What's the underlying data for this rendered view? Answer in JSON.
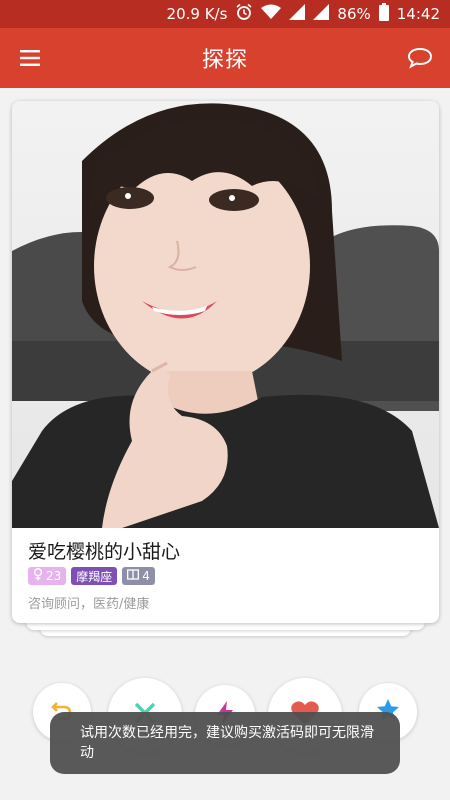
{
  "status_bar": {
    "speed": "20.9 K/s",
    "battery": "86%",
    "time": "14:42"
  },
  "app_bar": {
    "title": "探探"
  },
  "profile": {
    "name": "爱吃樱桃的小甜心",
    "age": "23",
    "zodiac": "摩羯座",
    "photo_count": "4",
    "occupation": "咨询顾问，医药/健康"
  },
  "toast": {
    "message": "试用次数已经用完，建议购买激活码即可无限滑动"
  },
  "colors": {
    "status_bar": "#b82d22",
    "app_bar": "#d9412f",
    "tag_age": "#e7b3ee",
    "tag_zodiac": "#7e4fb4",
    "tag_count": "#8f90a8",
    "undo": "#f2b233",
    "boost": "#c9359e",
    "like": "#e25b4d",
    "superlike": "#2c9be8"
  },
  "icons": {
    "menu": "menu-icon",
    "chat": "chat-bubble-icon",
    "undo": "undo-icon",
    "nope": "close-icon",
    "boost": "lightning-icon",
    "like": "heart-icon",
    "superlike": "star-icon"
  }
}
